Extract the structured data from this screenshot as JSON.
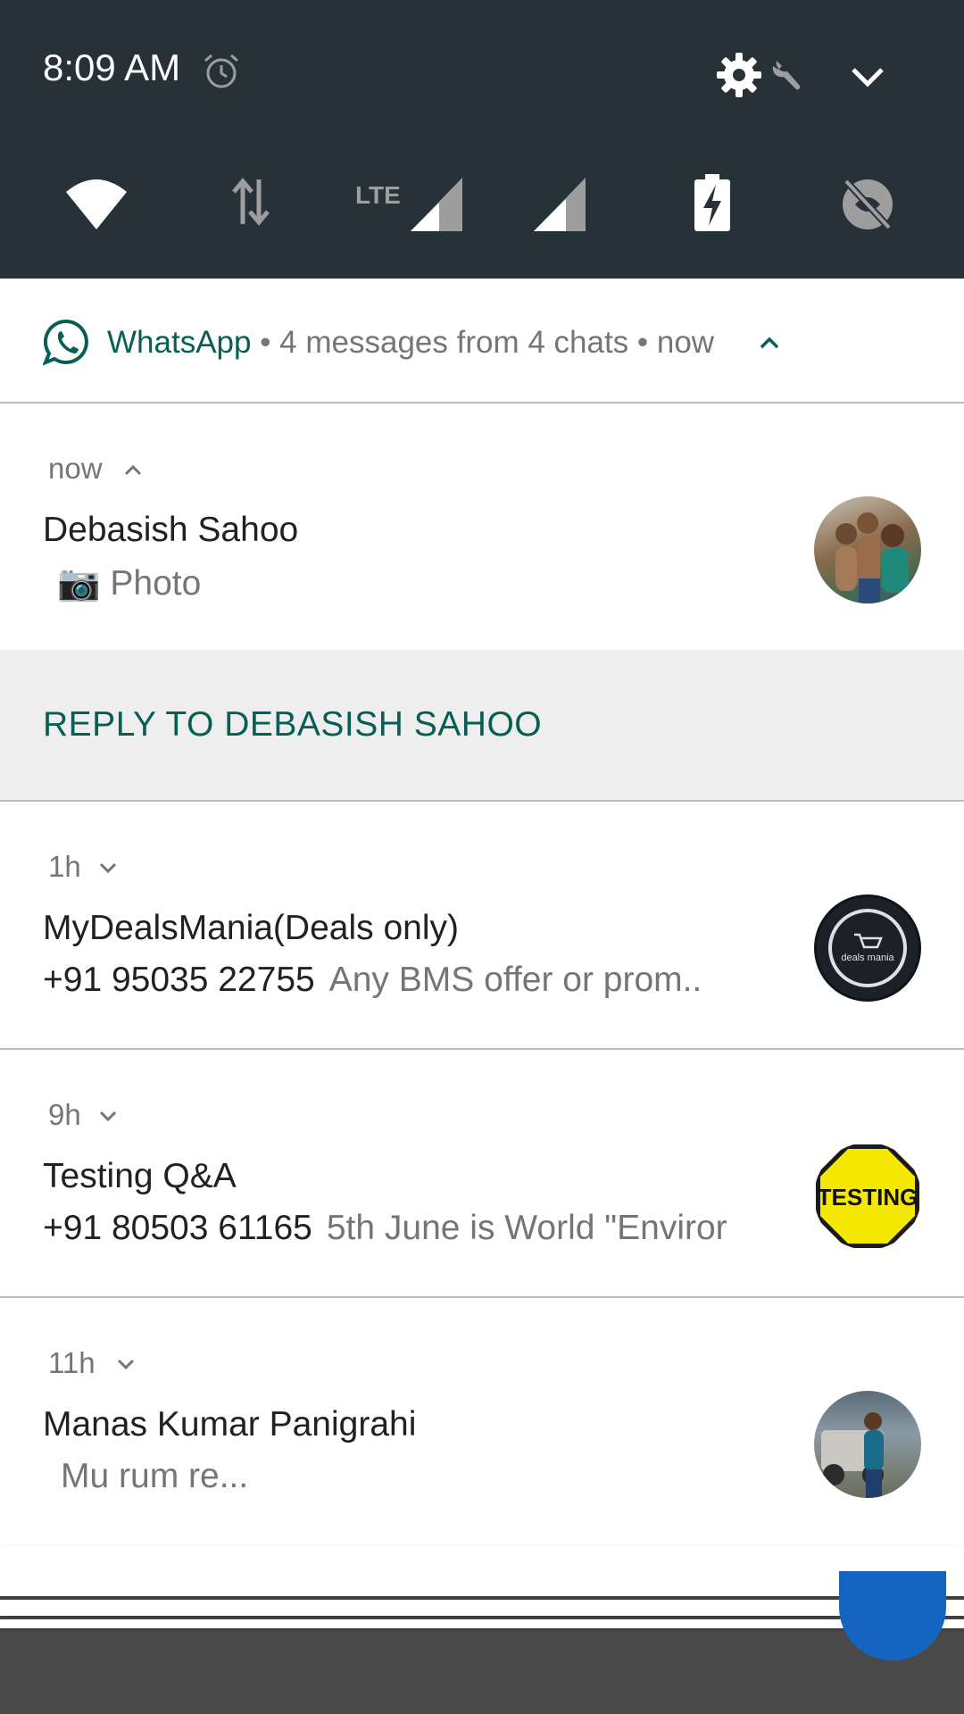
{
  "status_bar": {
    "time": "8:09 AM",
    "icons": [
      "alarm-icon",
      "settings-gear-icon",
      "wrench-icon",
      "collapse-chevron-icon"
    ],
    "quick_settings": [
      "wifi-icon",
      "data-transfer-icon",
      "lte-signal-icon",
      "signal-icon",
      "battery-charging-icon",
      "location-off-icon"
    ],
    "lte_label": "LTE"
  },
  "group_header": {
    "app_name": "WhatsApp",
    "summary": " • 4 messages from 4 chats • now",
    "accent": "#075e54"
  },
  "notifications": [
    {
      "time": "now",
      "title": "Debasish Sahoo",
      "sender": "",
      "message": "📷 Photo",
      "expanded": true
    },
    {
      "time": "1h",
      "title": "MyDealsMania(Deals only)",
      "sender": "+91 95035 22755",
      "message": "Any BMS offer or prom..",
      "expanded": false,
      "avatar_text": "deals mania"
    },
    {
      "time": "9h",
      "title": "Testing Q&A",
      "sender": "+91 80503 61165",
      "message": "5th June is World \"Enviror",
      "expanded": false,
      "avatar_text": "TESTING"
    },
    {
      "time": "11h",
      "title": "Manas Kumar Panigrahi",
      "sender": "",
      "message": "Mu rum re...",
      "expanded": false
    }
  ],
  "reply_action": "REPLY TO DEBASISH SAHOO",
  "colors": {
    "status_bg": "#263238",
    "whatsapp_green": "#075e54",
    "scrim": "#4a4a4a"
  }
}
